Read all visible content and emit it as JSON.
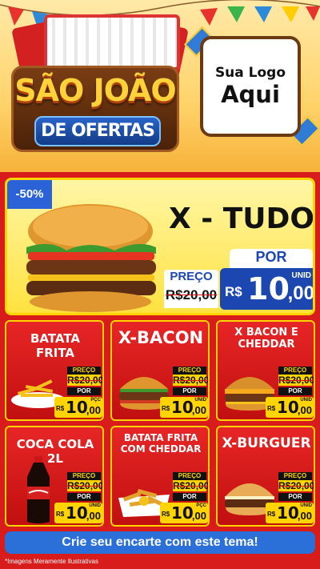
{
  "header": {
    "title_line1": "SÃO JOÃO",
    "title_line2": "DE OFERTAS",
    "logo_line1": "Sua Logo",
    "logo_line2": "Aqui"
  },
  "featured": {
    "badge": "-50%",
    "name": "X - TUDO",
    "preco_label": "PREÇO",
    "old_price": "R$20,00",
    "por_label": "POR",
    "currency": "R$",
    "price_int": "10",
    "price_cents": ",00",
    "unit": "UNID"
  },
  "cards": [
    {
      "name": "BATATA FRITA",
      "preco_label": "PREÇO",
      "old_price": "R$20,00",
      "por_label": "POR",
      "currency": "R$",
      "price_int": "10",
      "price_cents": ",00",
      "unit": "PÇC",
      "icon": "fries-icon"
    },
    {
      "name": "X-BACON",
      "preco_label": "PREÇO",
      "old_price": "R$20,00",
      "por_label": "POR",
      "currency": "R$",
      "price_int": "10",
      "price_cents": ",00",
      "unit": "UNID",
      "icon": "burger-icon"
    },
    {
      "name": "X BACON E CHEDDAR",
      "preco_label": "PREÇO",
      "old_price": "R$20,00",
      "por_label": "POR",
      "currency": "R$",
      "price_int": "10",
      "price_cents": ",00",
      "unit": "UNID",
      "icon": "burger-icon"
    },
    {
      "name": "COCA COLA 2L",
      "preco_label": "PREÇO",
      "old_price": "R$20,00",
      "por_label": "POR",
      "currency": "R$",
      "price_int": "10",
      "price_cents": ",00",
      "unit": "UNID",
      "icon": "soda-bottle-icon"
    },
    {
      "name": "BATATA FRITA COM CHEDDAR",
      "preco_label": "PREÇO",
      "old_price": "R$20,00",
      "por_label": "POR",
      "currency": "R$",
      "price_int": "10",
      "price_cents": ",00",
      "unit": "PÇC",
      "icon": "fries-cheddar-icon"
    },
    {
      "name": "X-BURGUER",
      "preco_label": "PREÇO",
      "old_price": "R$20,00",
      "por_label": "POR",
      "currency": "R$",
      "price_int": "10",
      "price_cents": ",00",
      "unit": "UNID",
      "icon": "burger-icon"
    }
  ],
  "cta": "Crie seu encarte com este tema!",
  "disclaimer": "*Imagens Meramente Ilustrativas",
  "colors": {
    "background": "#d81b1b",
    "accent_yellow": "#ffd400",
    "accent_blue": "#1d47b0"
  }
}
